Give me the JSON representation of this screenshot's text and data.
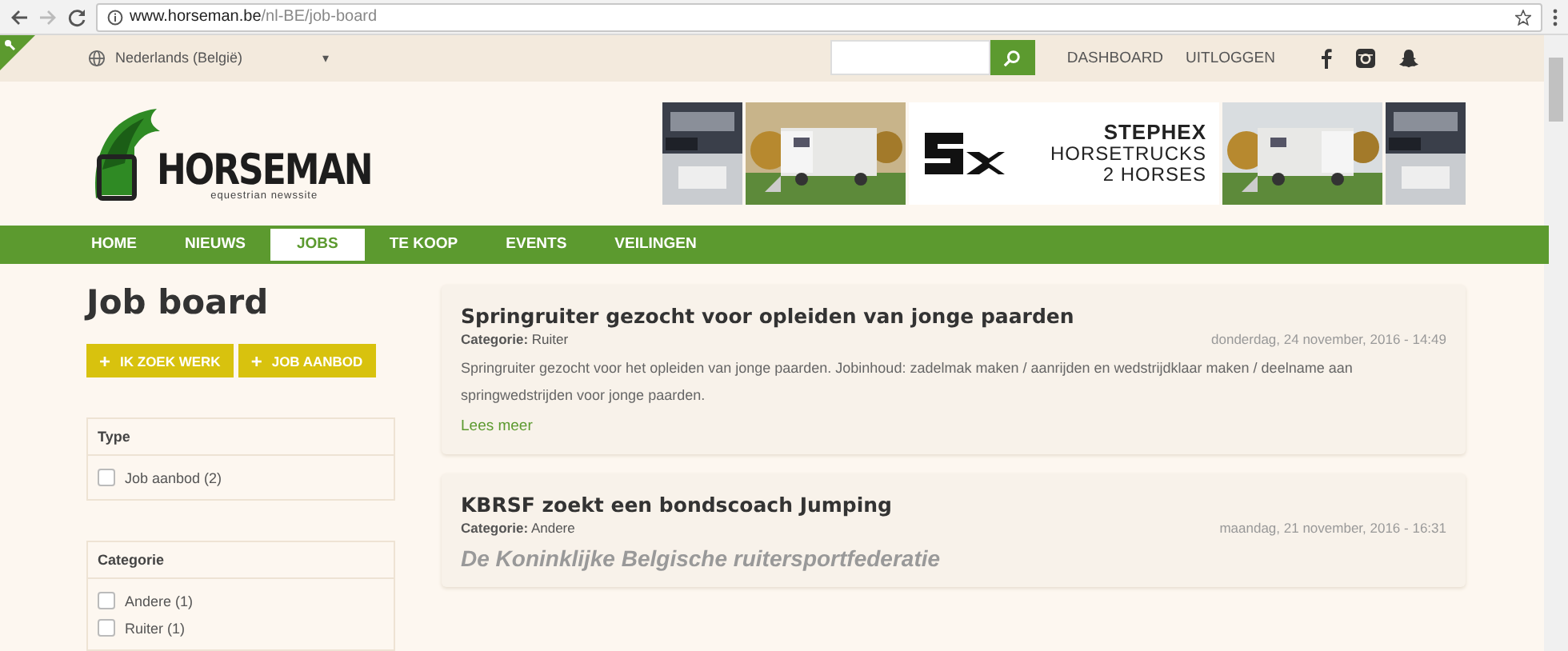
{
  "browser": {
    "url_host": "www.horseman.be",
    "url_path": "/nl-BE/job-board"
  },
  "topbar": {
    "language": "Nederlands (België)",
    "dropdown": "▾",
    "links": [
      "DASHBOARD",
      "UITLOGGEN"
    ]
  },
  "header": {
    "logo": {
      "name": "HORSEMAN",
      "tagline": "equestrian newssite"
    },
    "banner": {
      "lines": [
        "STEPHEX",
        "HORSETRUCKS",
        "2 HORSES"
      ]
    }
  },
  "nav": [
    {
      "label": "HOME",
      "selected": false
    },
    {
      "label": "NIEUWS",
      "selected": false
    },
    {
      "label": "JOBS",
      "selected": true
    },
    {
      "label": "TE KOOP",
      "selected": false
    },
    {
      "label": "EVENTS",
      "selected": false
    },
    {
      "label": "VEILINGEN",
      "selected": false
    }
  ],
  "page_title": "Job board",
  "actions": [
    {
      "icon": "+",
      "label": "IK ZOEK WERK"
    },
    {
      "icon": "+",
      "label": "JOB AANBOD"
    }
  ],
  "filters": [
    {
      "title": "Type",
      "options": [
        {
          "label": "Job aanbod (2)",
          "checked": false
        }
      ]
    },
    {
      "title": "Categorie",
      "options": [
        {
          "label": "Andere (1)",
          "checked": false
        },
        {
          "label": "Ruiter (1)",
          "checked": false
        }
      ]
    }
  ],
  "jobs": [
    {
      "title": "Springruiter gezocht voor opleiden van jonge paarden",
      "category_label": "Categorie:",
      "category": "Ruiter",
      "date": "donderdag, 24 november, 2016 - 14:49",
      "kind": "text",
      "body": "Springruiter gezocht voor het opleiden van jonge paarden. Jobinhoud: zadelmak maken / aanrijden en wedstrijdklaar maken / deelname aan springwedstrijden voor jonge paarden.",
      "link": "Lees meer"
    },
    {
      "title": "KBRSF zoekt een bondscoach Jumping",
      "category_label": "Categorie:",
      "category": "Andere",
      "date": "maandag, 21 november, 2016 - 16:31",
      "kind": "heading",
      "body": "De Koninklijke Belgische ruitersportfederatie"
    }
  ]
}
